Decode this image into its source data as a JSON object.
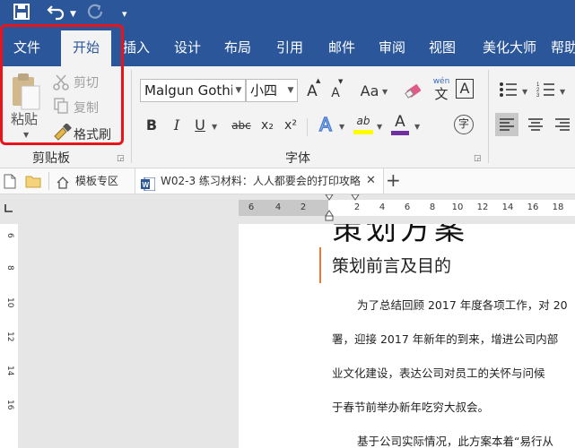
{
  "qat": {
    "save_icon": "save-icon",
    "undo_icon": "undo-icon",
    "redo_icon": "redo-icon",
    "customize_icon": "customize-qat-icon"
  },
  "tabs": [
    {
      "label": "文件",
      "active": false
    },
    {
      "label": "开始",
      "active": true
    },
    {
      "label": "插入",
      "active": false
    },
    {
      "label": "设计",
      "active": false
    },
    {
      "label": "布局",
      "active": false
    },
    {
      "label": "引用",
      "active": false
    },
    {
      "label": "邮件",
      "active": false
    },
    {
      "label": "审阅",
      "active": false
    },
    {
      "label": "视图",
      "active": false
    },
    {
      "label": "美化大师",
      "active": false
    },
    {
      "label": "帮助",
      "active": false
    }
  ],
  "clipboard": {
    "paste": "粘贴",
    "cut": "剪切",
    "copy": "复制",
    "format_painter": "格式刷",
    "group_label": "剪贴板"
  },
  "font": {
    "font_name": "Malgun Gothi",
    "font_size": "小四",
    "group_label": "字体",
    "bold": "B",
    "italic": "I",
    "underline": "U",
    "strike": "abc",
    "sub": "x₂",
    "sup": "x²",
    "grow": "A",
    "shrink": "A",
    "case": "Aa",
    "phonetic": "wén",
    "phonetic_top": "文",
    "border_char": "A",
    "effects": "A",
    "highlight": "ab",
    "font_color": "A",
    "enclose": "字"
  },
  "doc_tabs": {
    "template_tab": "模板专区",
    "active_tab": "W02-3 练习材料：人人都要会的打印攻略",
    "close_glyph": "✕",
    "add_glyph": "+"
  },
  "ruler": {
    "h_ticks": [
      "6",
      "4",
      "2",
      "2",
      "4",
      "6",
      "8",
      "10",
      "12",
      "14",
      "16",
      "18"
    ],
    "v_ticks": [
      "6",
      "8",
      "10",
      "12",
      "14",
      "16"
    ]
  },
  "document": {
    "title": "策划方案",
    "heading": "策划前言及目的",
    "lines": [
      "为了总结回顾 2017 年度各项工作，对 20",
      "署，迎接 2017 年新年的到来，增进公司内部",
      "业文化建设，表达公司对员工的关怀与问候",
      "于春节前举办新年吃穷大叔会。",
      "基于公司实际情况，此方案本着“易行从"
    ]
  },
  "colors": {
    "ribbon_blue": "#2b579a",
    "highlight_red": "#e8141c",
    "heading_accent": "#e07b39",
    "highlight_yellow": "#ffff00",
    "font_red": "#c00000",
    "effects_blue": "#4a7ed0"
  }
}
